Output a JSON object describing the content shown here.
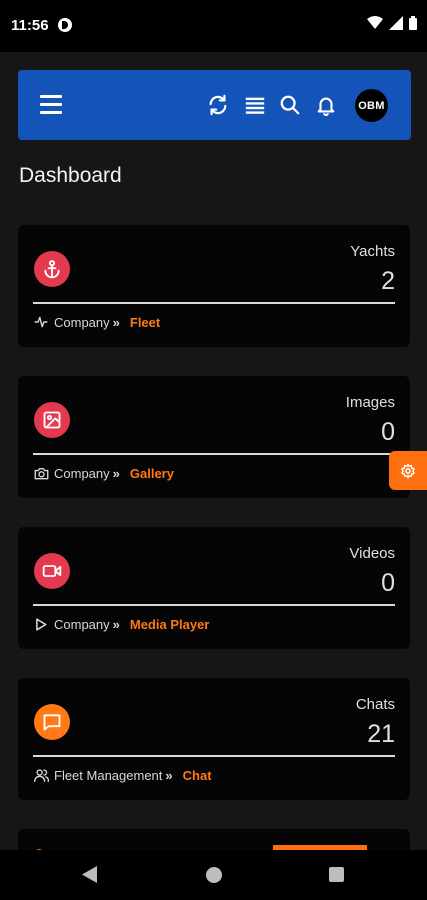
{
  "status_bar": {
    "time": "11:56"
  },
  "app_bar": {
    "avatar_text": "OBM"
  },
  "page": {
    "title": "Dashboard"
  },
  "cards": [
    {
      "label": "Yachts",
      "value": "2",
      "breadcrumb": "Company",
      "link": "Fleet",
      "icon": "anchor-icon",
      "footer_icon": "activity-icon",
      "color": "#e53950"
    },
    {
      "label": "Images",
      "value": "0",
      "breadcrumb": "Company",
      "link": "Gallery",
      "icon": "image-icon",
      "footer_icon": "camera-icon",
      "color": "#e53950"
    },
    {
      "label": "Videos",
      "value": "0",
      "breadcrumb": "Company",
      "link": "Media Player",
      "icon": "video-icon",
      "footer_icon": "play-icon",
      "color": "#e53950"
    },
    {
      "label": "Chats",
      "value": "21",
      "breadcrumb": "Fleet Management",
      "link": "Chat",
      "icon": "chat-icon",
      "footer_icon": "users-icon",
      "color": "#ff7a16"
    }
  ],
  "breadcrumb_separator": "»",
  "colors": {
    "app_bar": "#1453b8",
    "accent": "#ff7a16",
    "danger": "#e53950",
    "background": "#161618",
    "card": "#050505"
  }
}
